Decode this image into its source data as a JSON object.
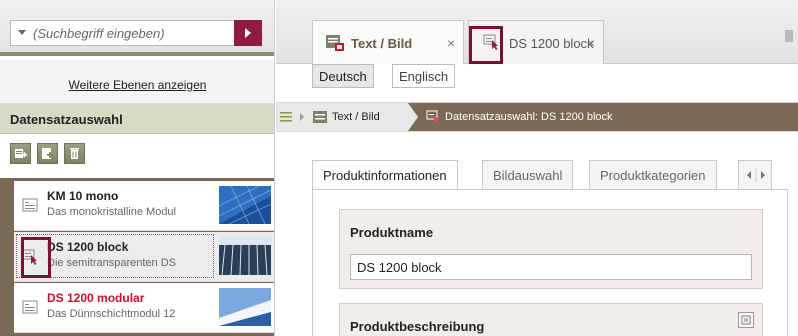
{
  "search": {
    "placeholder": "(Suchbegriff eingeben)"
  },
  "sidebar": {
    "more_levels": "Weitere Ebenen anzeigen",
    "section_title": "Datensatzauswahl",
    "toolbar": [
      "new-record-icon",
      "add-icon",
      "delete-icon"
    ],
    "items": [
      {
        "title": "KM 10 mono",
        "desc": "Das monokristalline Modul",
        "icon": "text-image-record-icon",
        "thumb": "solar-panel-thumbnail"
      },
      {
        "title": "DS 1200 block",
        "desc": "Die semitransparenten DS",
        "icon": "record-cursor-icon",
        "thumb": "solar-panel-thumbnail"
      },
      {
        "title": "DS 1200 modular",
        "desc": "Das Dünnschichtmodul 12",
        "icon": "text-image-record-icon",
        "thumb": "solar-panel-thumbnail"
      }
    ]
  },
  "tabs": [
    {
      "label": "Text / Bild",
      "close": "×",
      "icon": "text-image-red-icon"
    },
    {
      "label": "DS 1200 block",
      "close": "×",
      "icon": "record-cursor-icon"
    }
  ],
  "languages": [
    "Deutsch",
    "Englisch"
  ],
  "breadcrumb": {
    "item1": "Text / Bild",
    "active": "Datensatzauswahl: DS 1200 block"
  },
  "content_tabs": [
    "Produktinformationen",
    "Bildauswahl",
    "Produktkategorien"
  ],
  "form": {
    "name_label": "Produktname",
    "name_value": "DS 1200 block",
    "desc_label": "Produktbeschreibung"
  },
  "colors": {
    "accent": "#8e1c45",
    "highlight": "#7a1035",
    "brown": "#7a6a55",
    "green_header": "#d6dcc3",
    "red_title": "#c8102e"
  }
}
